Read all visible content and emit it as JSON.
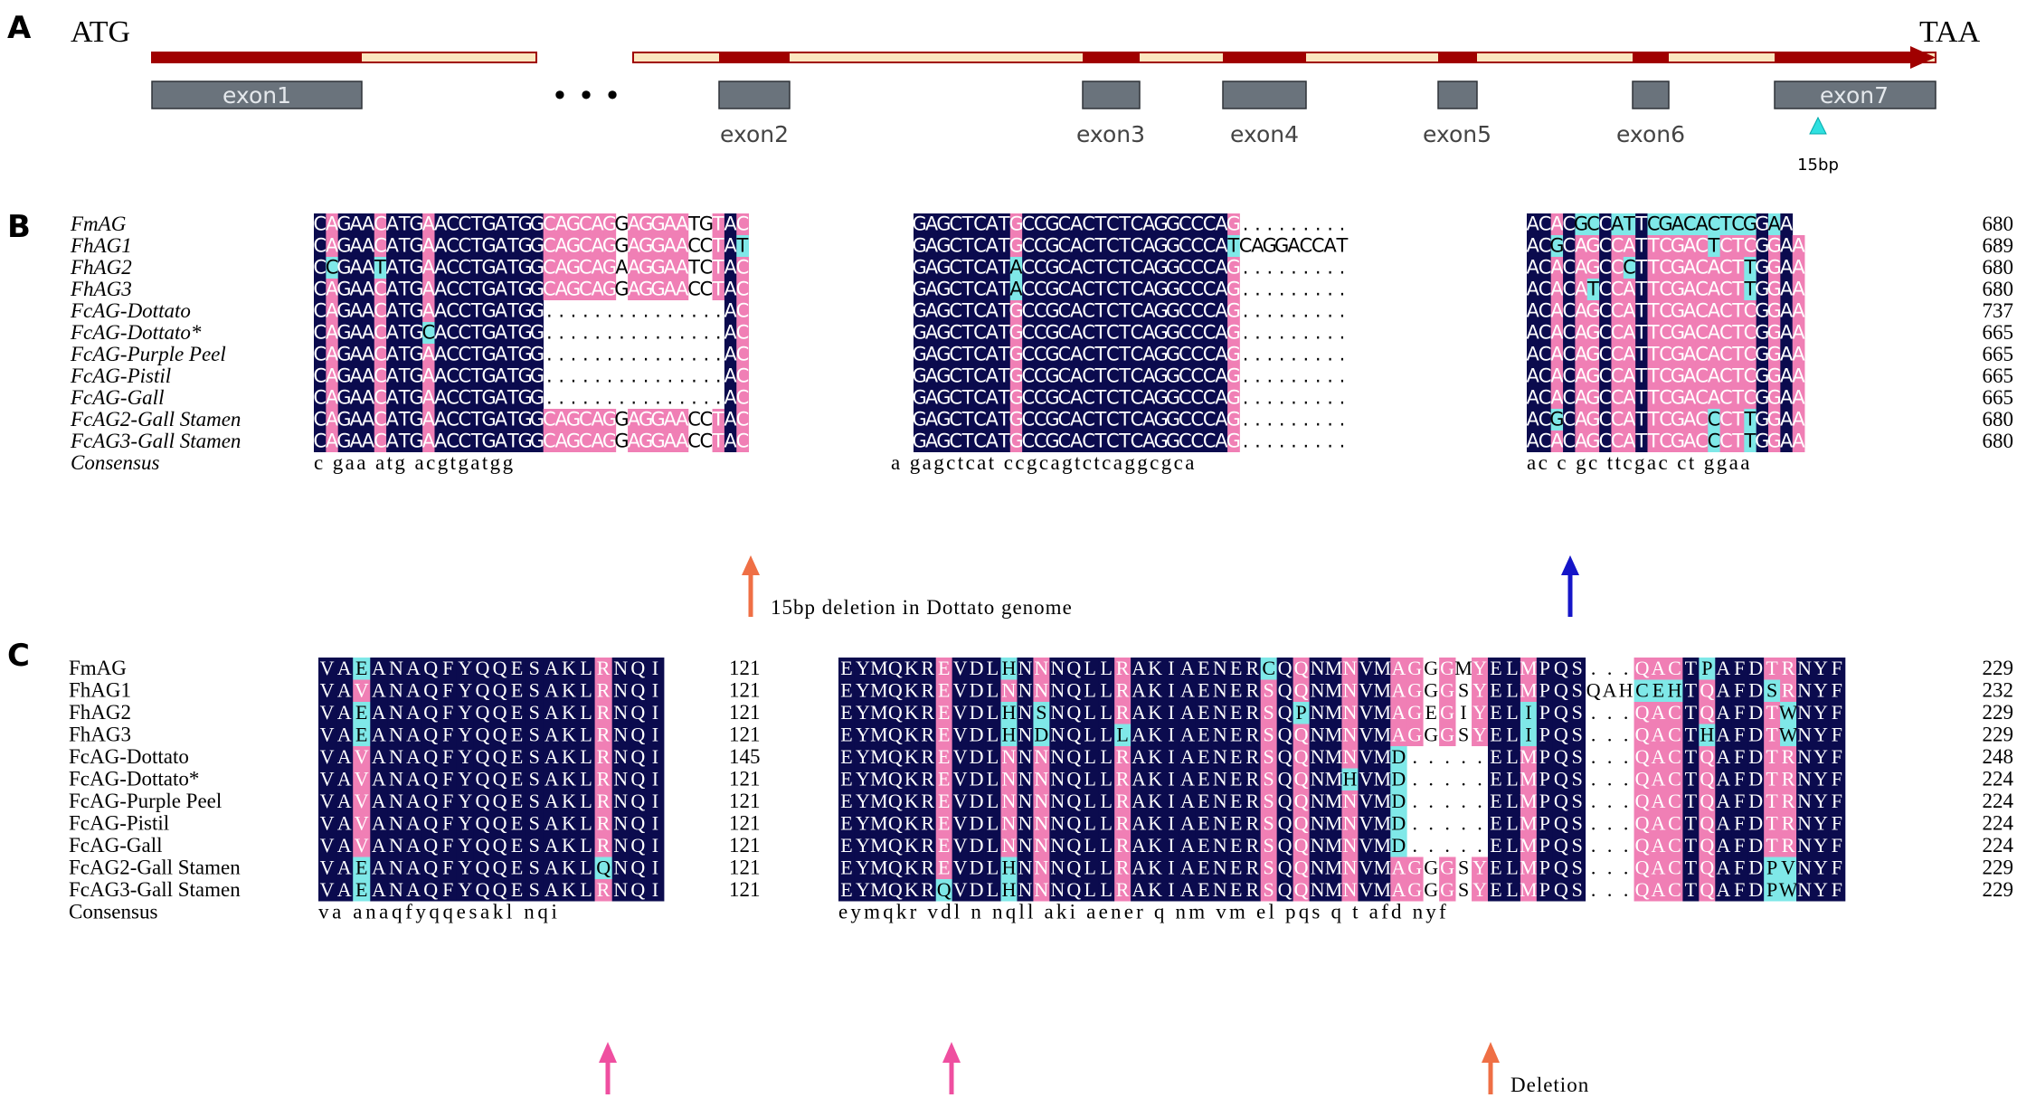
{
  "colors": {
    "dark": "#0b0b4e",
    "pink": "#f07fb5",
    "cyan": "#7fe8e8",
    "gene_red": "#a00000",
    "gene_cream": "#fbe6bf",
    "exon_gray": "#6a737c",
    "arrow_orange": "#ef6f45",
    "arrow_blue": "#1515c8",
    "arrow_pink": "#ef4fa0",
    "marker_cyan": "#2fe0e0"
  },
  "panel_a": {
    "label": "A",
    "start_codon": "ATG",
    "stop_codon": "TAA",
    "ellipsis": "• • •",
    "exons": [
      "exon1",
      "exon2",
      "exon3",
      "exon4",
      "exon5",
      "exon6",
      "exon7"
    ],
    "marker_label": "15bp"
  },
  "panel_b": {
    "label": "B",
    "names": [
      "FmAG",
      "FhAG1",
      "FhAG2",
      "FhAG3",
      "FcAG-Dottato",
      "FcAG-Dottato*",
      "FcAG-Purple Peel",
      "FcAG-Pistil",
      "FcAG-Gall",
      "FcAG2-Gall Stamen",
      "FcAG3-Gall Stamen"
    ],
    "numbers": [
      "680",
      "689",
      "680",
      "680",
      "737",
      "665",
      "665",
      "665",
      "665",
      "680",
      "680"
    ],
    "left_seqs": [
      "CAGAACATGAACCTGATGGCAGCAGGAGGAATGTAC",
      "CAGAACATGAACCTGATGGCAGCAGGAGGAACCTAT",
      "CCGAATATGAACCTGATGGCAGCAGAAGGAATCTAC",
      "CAGAACATGAACCTGATGGCAGCAGGAGGAACCTAC",
      "CAGAACATGAACCTGATGG...............AC",
      "CAGAACATGCACCTGATGG...............AC",
      "CAGAACATGAACCTGATGG...............AC",
      "CAGAACATGAACCTGATGG...............AC",
      "CAGAACATGAACCTGATGG...............AC",
      "CAGAACATGAACCTGATGGCAGCAGGAGGAACCTAC",
      "CAGAACATGAACCTGATGGCAGCAGGAGGAACCTAC"
    ],
    "mid_seqs": [
      "GAGCTCATGCCGCACTCTCAGGCCCAG.........",
      "GAGCTCATGCCGCACTCTCAGGCCCATCAGGACCAT",
      "GAGCTCATACCGCACTCTCAGGCCCAG.........",
      "GAGCTCATACCGCACTCTCAGGCCCAG.........",
      "GAGCTCATGCCGCACTCTCAGGCCCAG.........",
      "GAGCTCATGCCGCACTCTCAGGCCCAG.........",
      "GAGCTCATGCCGCACTCTCAGGCCCAG.........",
      "GAGCTCATGCCGCACTCTCAGGCCCAG.........",
      "GAGCTCATGCCGCACTCTCAGGCCCAG.........",
      "GAGCTCATGCCGCACTCTCAGGCCCAG.........",
      "GAGCTCATGCCGCACTCTCAGGCCCAG........."
    ],
    "right_seqs": [
      "ACACGCCATTCGACACTCGGAA",
      "ACGCAGCCATTCGACTCTCGGAA",
      "ACACAGCCCTTCGACACTTGGAA",
      "ACACATCCATTCGACACTTGGAA",
      "ACACAGCCATTCGACACTCGGAA",
      "ACACAGCCATTCGACACTCGGAA",
      "ACACAGCCATTCGACACTCGGAA",
      "ACACAGCCATTCGACACTCGGAA",
      "ACACAGCCATTCGACACTCGGAA",
      "ACGCAGCCATTCGACCCTTGGAA",
      "ACACAGCCATTCGACCCTTGGAA"
    ],
    "consensus_label": "Consensus",
    "consensus_left": "c gaa atg acgtgatgg",
    "consensus_mid": "a gagctcat ccgcagtctcaggcgca",
    "consensus_right": "ac c gc ttcgac ct ggaa",
    "deletion_label": "15bp deletion in Dottato genome"
  },
  "panel_c": {
    "label": "C",
    "names": [
      "FmAG",
      "FhAG1",
      "FhAG2",
      "FhAG3",
      "FcAG-Dottato",
      "FcAG-Dottato*",
      "FcAG-Purple Peel",
      "FcAG-Pistil",
      "FcAG-Gall",
      "FcAG2-Gall Stamen",
      "FcAG3-Gall Stamen"
    ],
    "left_seqs": [
      "VAEANAQFYQQESAKLRNQI",
      "VAVANAQFYQQESAKLRNQI",
      "VAEANAQFYQQESAKLRNQI",
      "VAEANAQFYQQESAKLRNQI",
      "VAVANAQFYQQESAKLRNQI",
      "VAVANAQFYQQESAKLRNQI",
      "VAVANAQFYQQESAKLRNQI",
      "VAVANAQFYQQESAKLRNQI",
      "VAVANAQFYQQESAKLRNQI",
      "VAEANAQFYQQESAKLQNQI",
      "VAEANAQFYQQESAKLRNQI"
    ],
    "left_numbers": [
      "121",
      "121",
      "121",
      "121",
      "145",
      "121",
      "121",
      "121",
      "121",
      "121",
      "121"
    ],
    "right_seqs": [
      "EYMQKREVDLHNNNQLLRAKIAENERCQQNMNVMAGGGMYELMPQS...QACTPAFDTRNYF",
      "EYMQKREVDLNNNNQLLRAKIAENERSQQNMNVMAGGGSYELMPQSQAHCEHTQAFDSRNYF",
      "EYMQKREVDLHNSNQLLRAKIAENERSQPNMNVMAGEGIYELIPQS...QACTQAFDTWNYF",
      "EYMQKREVDLHNDNQLLLAKIAENERSQQNMNVMAGGGSYELIPQS...QACTHAFDTWNYF",
      "EYMQKREVDLNNNNQLLRAKIAENERSQQNMNVMD.....ELMPQS...QACTQAFDTRNYF",
      "EYMQKREVDLNNNNQLLRAKIAENERSQQNMHVMD.....ELMPQS...QACTQAFDTRNYF",
      "EYMQKREVDLNNNNQLLRAKIAENERSQQNMNVMD.....ELMPQS...QACTQAFDTRNYF",
      "EYMQKREVDLNNNNQLLRAKIAENERSQQNMNVMD.....ELMPQS...QACTQAFDTRNYF",
      "EYMQKREVDLNNNNQLLRAKIAENERSQQNMNVMD.....ELMPQS...QACTQAFDTRNYF",
      "EYMQKREVDLHNNNQLLRAKIAENERSQQNMNVMAGGGSYELMPQS...QACTQAFDPVNYF",
      "EYMQKRQVDLHNNNQLLRAKIAENERSQQNMNVMAGGGSYELMPQS...QACTQAFDPWNYF"
    ],
    "right_numbers": [
      "229",
      "232",
      "229",
      "229",
      "248",
      "224",
      "224",
      "224",
      "224",
      "229",
      "229"
    ],
    "consensus_label": "Consensus",
    "consensus_left": "va anaqfyqqesakl nqi",
    "consensus_right": "eymqkr vdl n nqll aki aener q nm vm el pqs q t afd nyf",
    "deletion_label": "Deletion"
  }
}
